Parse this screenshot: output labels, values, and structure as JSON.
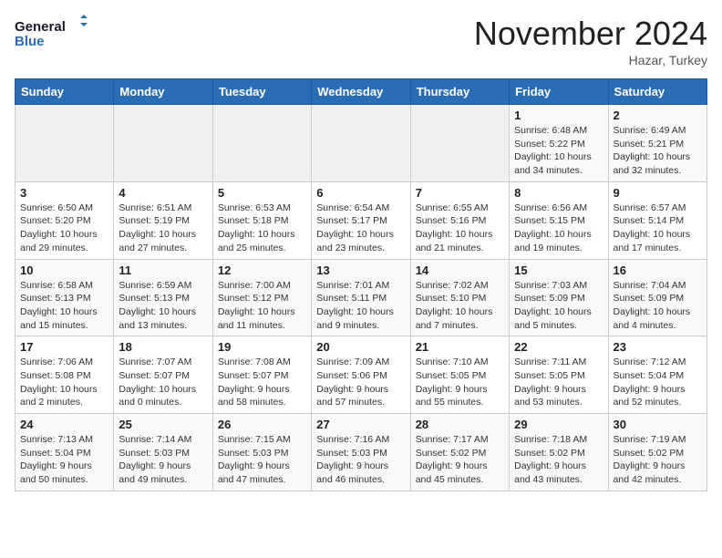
{
  "logo": {
    "line1": "General",
    "line2": "Blue"
  },
  "title": "November 2024",
  "location": "Hazar, Turkey",
  "weekdays": [
    "Sunday",
    "Monday",
    "Tuesday",
    "Wednesday",
    "Thursday",
    "Friday",
    "Saturday"
  ],
  "weeks": [
    [
      {
        "day": "",
        "info": ""
      },
      {
        "day": "",
        "info": ""
      },
      {
        "day": "",
        "info": ""
      },
      {
        "day": "",
        "info": ""
      },
      {
        "day": "",
        "info": ""
      },
      {
        "day": "1",
        "info": "Sunrise: 6:48 AM\nSunset: 5:22 PM\nDaylight: 10 hours and 34 minutes."
      },
      {
        "day": "2",
        "info": "Sunrise: 6:49 AM\nSunset: 5:21 PM\nDaylight: 10 hours and 32 minutes."
      }
    ],
    [
      {
        "day": "3",
        "info": "Sunrise: 6:50 AM\nSunset: 5:20 PM\nDaylight: 10 hours and 29 minutes."
      },
      {
        "day": "4",
        "info": "Sunrise: 6:51 AM\nSunset: 5:19 PM\nDaylight: 10 hours and 27 minutes."
      },
      {
        "day": "5",
        "info": "Sunrise: 6:53 AM\nSunset: 5:18 PM\nDaylight: 10 hours and 25 minutes."
      },
      {
        "day": "6",
        "info": "Sunrise: 6:54 AM\nSunset: 5:17 PM\nDaylight: 10 hours and 23 minutes."
      },
      {
        "day": "7",
        "info": "Sunrise: 6:55 AM\nSunset: 5:16 PM\nDaylight: 10 hours and 21 minutes."
      },
      {
        "day": "8",
        "info": "Sunrise: 6:56 AM\nSunset: 5:15 PM\nDaylight: 10 hours and 19 minutes."
      },
      {
        "day": "9",
        "info": "Sunrise: 6:57 AM\nSunset: 5:14 PM\nDaylight: 10 hours and 17 minutes."
      }
    ],
    [
      {
        "day": "10",
        "info": "Sunrise: 6:58 AM\nSunset: 5:13 PM\nDaylight: 10 hours and 15 minutes."
      },
      {
        "day": "11",
        "info": "Sunrise: 6:59 AM\nSunset: 5:13 PM\nDaylight: 10 hours and 13 minutes."
      },
      {
        "day": "12",
        "info": "Sunrise: 7:00 AM\nSunset: 5:12 PM\nDaylight: 10 hours and 11 minutes."
      },
      {
        "day": "13",
        "info": "Sunrise: 7:01 AM\nSunset: 5:11 PM\nDaylight: 10 hours and 9 minutes."
      },
      {
        "day": "14",
        "info": "Sunrise: 7:02 AM\nSunset: 5:10 PM\nDaylight: 10 hours and 7 minutes."
      },
      {
        "day": "15",
        "info": "Sunrise: 7:03 AM\nSunset: 5:09 PM\nDaylight: 10 hours and 5 minutes."
      },
      {
        "day": "16",
        "info": "Sunrise: 7:04 AM\nSunset: 5:09 PM\nDaylight: 10 hours and 4 minutes."
      }
    ],
    [
      {
        "day": "17",
        "info": "Sunrise: 7:06 AM\nSunset: 5:08 PM\nDaylight: 10 hours and 2 minutes."
      },
      {
        "day": "18",
        "info": "Sunrise: 7:07 AM\nSunset: 5:07 PM\nDaylight: 10 hours and 0 minutes."
      },
      {
        "day": "19",
        "info": "Sunrise: 7:08 AM\nSunset: 5:07 PM\nDaylight: 9 hours and 58 minutes."
      },
      {
        "day": "20",
        "info": "Sunrise: 7:09 AM\nSunset: 5:06 PM\nDaylight: 9 hours and 57 minutes."
      },
      {
        "day": "21",
        "info": "Sunrise: 7:10 AM\nSunset: 5:05 PM\nDaylight: 9 hours and 55 minutes."
      },
      {
        "day": "22",
        "info": "Sunrise: 7:11 AM\nSunset: 5:05 PM\nDaylight: 9 hours and 53 minutes."
      },
      {
        "day": "23",
        "info": "Sunrise: 7:12 AM\nSunset: 5:04 PM\nDaylight: 9 hours and 52 minutes."
      }
    ],
    [
      {
        "day": "24",
        "info": "Sunrise: 7:13 AM\nSunset: 5:04 PM\nDaylight: 9 hours and 50 minutes."
      },
      {
        "day": "25",
        "info": "Sunrise: 7:14 AM\nSunset: 5:03 PM\nDaylight: 9 hours and 49 minutes."
      },
      {
        "day": "26",
        "info": "Sunrise: 7:15 AM\nSunset: 5:03 PM\nDaylight: 9 hours and 47 minutes."
      },
      {
        "day": "27",
        "info": "Sunrise: 7:16 AM\nSunset: 5:03 PM\nDaylight: 9 hours and 46 minutes."
      },
      {
        "day": "28",
        "info": "Sunrise: 7:17 AM\nSunset: 5:02 PM\nDaylight: 9 hours and 45 minutes."
      },
      {
        "day": "29",
        "info": "Sunrise: 7:18 AM\nSunset: 5:02 PM\nDaylight: 9 hours and 43 minutes."
      },
      {
        "day": "30",
        "info": "Sunrise: 7:19 AM\nSunset: 5:02 PM\nDaylight: 9 hours and 42 minutes."
      }
    ]
  ]
}
